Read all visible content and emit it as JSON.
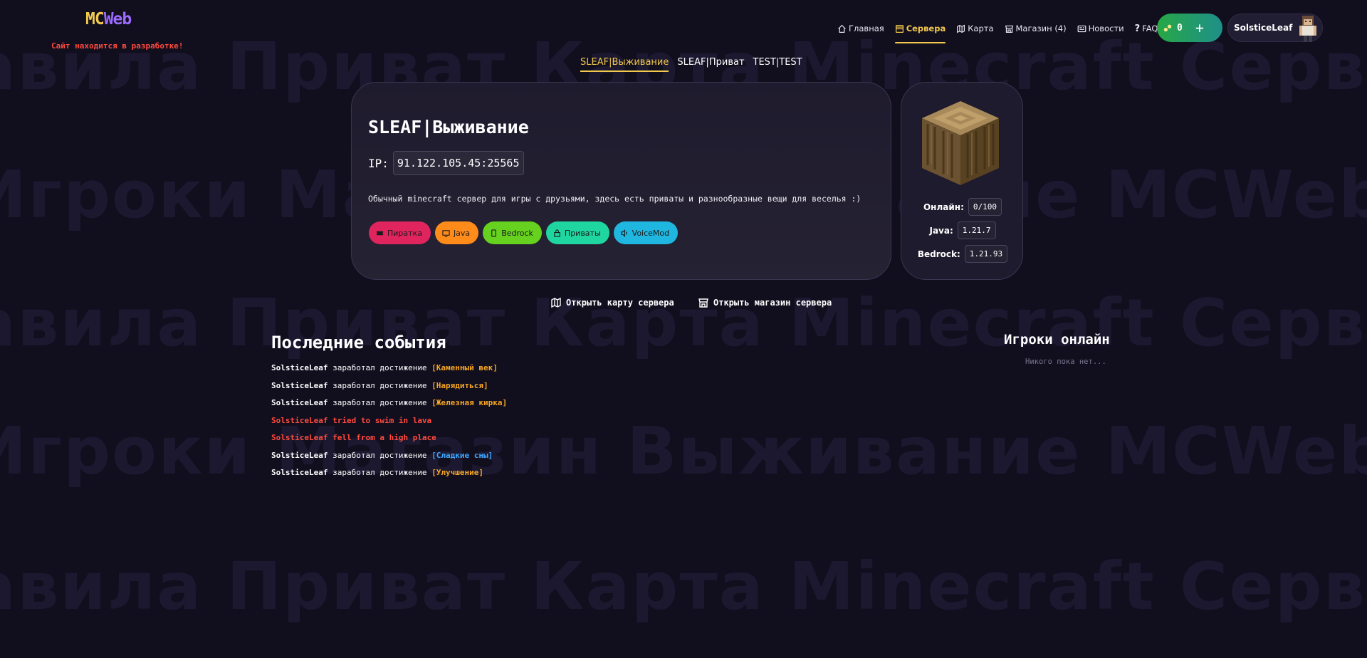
{
  "header": {
    "logo_mc": "MC",
    "logo_web": "Web",
    "dev_notice": "Сайт находится в разработке!"
  },
  "nav": {
    "items": [
      {
        "label": "Главная",
        "icon": "home-icon"
      },
      {
        "label": "Сервера",
        "icon": "server-icon",
        "active": true
      },
      {
        "label": "Карта",
        "icon": "map-icon"
      },
      {
        "label": "Магазин (4)",
        "icon": "store-icon"
      },
      {
        "label": "Новости",
        "icon": "news-icon"
      },
      {
        "label": "FAQ",
        "icon": "question-icon"
      }
    ],
    "balance": "0",
    "username": "SolsticeLeaf"
  },
  "server_tabs": [
    "SLEAF|Выживание",
    "SLEAF|Приват",
    "TEST|TEST"
  ],
  "server": {
    "title": "SLEAF|Выживание",
    "ip_label": "IP:",
    "ip": "91.122.105.45:25565",
    "description": "Обычный minecraft сервер для игры с друзьями, здесь есть приваты и разнообразные вещи для веселья :)",
    "tags": [
      {
        "label": "Пиратка",
        "color": "#e0245e",
        "icon": "ticket-icon"
      },
      {
        "label": "Java",
        "color": "#ff8c1a",
        "icon": "monitor-icon"
      },
      {
        "label": "Bedrock",
        "color": "#66d11e",
        "icon": "phone-icon"
      },
      {
        "label": "Приваты",
        "color": "#1fd6a0",
        "icon": "lock-icon"
      },
      {
        "label": "VoiceMod",
        "color": "#1fb6e0",
        "icon": "speaker-icon"
      }
    ]
  },
  "stats": {
    "online_label": "Онлайн:",
    "online_value": "0/100",
    "java_label": "Java:",
    "java_value": "1.21.7",
    "bedrock_label": "Bedrock:",
    "bedrock_value": "1.21.93"
  },
  "actions": {
    "map_link": "Открыть карту сервера",
    "store_link": "Открыть магазин сервера"
  },
  "events": {
    "title": "Последние события",
    "items": [
      {
        "player": "SolsticeLeaf",
        "text": " заработал достижение ",
        "adv": "[Каменный век]",
        "kind": "orange"
      },
      {
        "player": "SolsticeLeaf",
        "text": " заработал достижение ",
        "adv": "[Нарядиться]",
        "kind": "orange"
      },
      {
        "player": "SolsticeLeaf",
        "text": " заработал достижение ",
        "adv": "[Железная кирка]",
        "kind": "orange"
      },
      {
        "player": "SolsticeLeaf",
        "text": " tried to swim in lava",
        "adv": "",
        "kind": "death"
      },
      {
        "player": "SolsticeLeaf",
        "text": " fell from a high place",
        "adv": "",
        "kind": "death"
      },
      {
        "player": "SolsticeLeaf",
        "text": " заработал достижение ",
        "adv": "[Сладкие сны]",
        "kind": "blue"
      },
      {
        "player": "SolsticeLeaf",
        "text": " заработал достижение ",
        "adv": "[Улучшение]",
        "kind": "orange"
      }
    ]
  },
  "players": {
    "title": "Игроки онлайн",
    "empty": "Никого пока нет..."
  },
  "background_words": [
    "авила Приват Карта Minecraft Сервер Игроки",
    "Игроки Магазин Выживание MCWeb SLEAF Выживание",
    "авила Приват Карта Minecraft Сервер Игроки",
    "Игроки Магазин Выживание MCWeb SLEAF Выживание",
    "авила Приват Карта Minecraft Сервер Игроки"
  ],
  "colors": {
    "background": "#110e1e",
    "accent": "#f2c94c",
    "logo_web": "#9b6bff",
    "error": "#ff4b3e",
    "advancement": "#f5a623",
    "advancement_alt": "#3da8ff"
  }
}
